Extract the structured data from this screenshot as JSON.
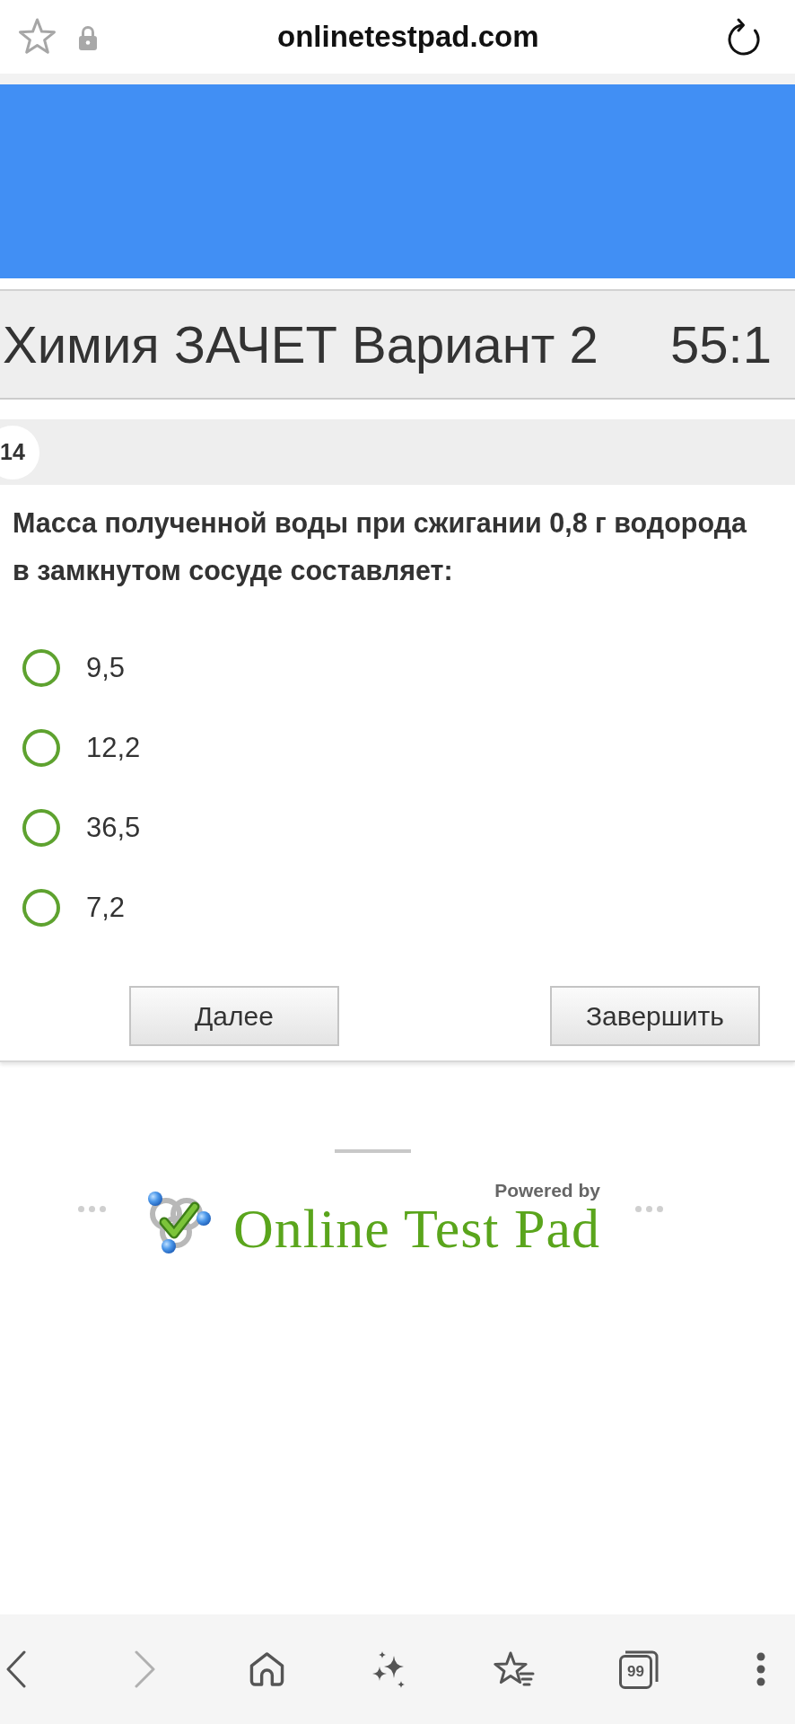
{
  "browser": {
    "url": "onlinetestpad.com"
  },
  "test": {
    "title": "Химия ЗАЧЕТ Вариант 2",
    "timer": "55:1"
  },
  "question": {
    "number": "14",
    "text": "Масса полученной воды при сжигании 0,8 г водорода в замкнутом сосуде составляет:",
    "options": [
      {
        "label": "9,5",
        "selected": false
      },
      {
        "label": "12,2",
        "selected": false
      },
      {
        "label": "36,5",
        "selected": false
      },
      {
        "label": "7,2",
        "selected": false
      }
    ]
  },
  "buttons": [
    {
      "label": "Далее"
    },
    {
      "label": "Завершить"
    }
  ],
  "footer": {
    "powered_by": "Powered by",
    "brand": "Online Test Pad"
  },
  "toolbar": {
    "back": {
      "disabled": false
    },
    "forward": {
      "disabled": true
    },
    "tab_count": "99"
  }
}
